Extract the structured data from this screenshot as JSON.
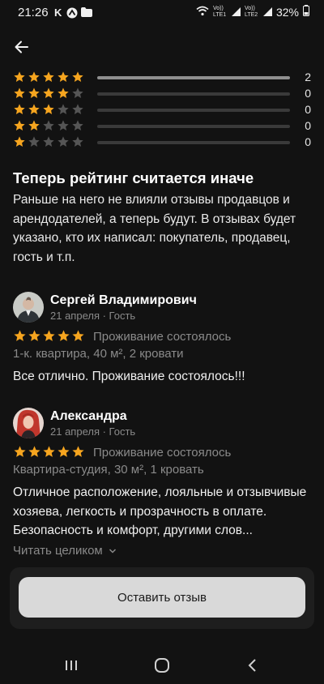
{
  "status_bar": {
    "time": "21:26",
    "notif_k": "K",
    "net_left": "Vo)) LTE1",
    "net_right": "Vo)) LTE2",
    "battery": "32%"
  },
  "colors": {
    "star": "#f6a51f",
    "star_empty": "#555555",
    "bar_fill": "#8f8f8f",
    "bar_track": "#3a3a3a"
  },
  "rating_breakdown": [
    {
      "stars": 5,
      "count": "2",
      "fraction": 1.0
    },
    {
      "stars": 4,
      "count": "0",
      "fraction": 0
    },
    {
      "stars": 3,
      "count": "0",
      "fraction": 0
    },
    {
      "stars": 2,
      "count": "0",
      "fraction": 0
    },
    {
      "stars": 1,
      "count": "0",
      "fraction": 0
    }
  ],
  "notice": {
    "title": "Теперь рейтинг считается иначе",
    "text": "Раньше на него не влияли отзывы продавцов и арендодателей, а теперь будут. В отзывах будет указано, кто их написал: покупатель, продавец, гость и т.п."
  },
  "reviews": [
    {
      "author": "Сергей Владимирович",
      "meta": "21 апреля · Гость",
      "rating": 5,
      "stay": "Проживание состоялось",
      "property": "1-к. квартира, 40 м², 2 кровати",
      "text": "Все отлично. Проживание состоялось!!!"
    },
    {
      "author": "Александра",
      "meta": "21 апреля · Гость",
      "rating": 5,
      "stay": "Проживание состоялось",
      "property": "Квартира-студия, 30 м², 1 кровать",
      "text": "Отличное расположение, лояльные и отзывчивые хозяева, легкость и прозрачность в оплате. Безопасность и комфорт, другими слов...",
      "read_more": "Читать целиком"
    }
  ],
  "actions": {
    "leave_review": "Оставить отзыв"
  }
}
